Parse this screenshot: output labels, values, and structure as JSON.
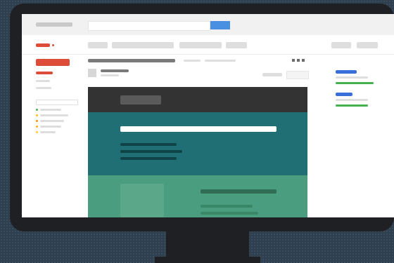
{
  "colors": {
    "background": "#2e3f4f",
    "bezel": "#1e2023",
    "brand_red": "#dd4b39",
    "search_blue": "#4a90e2",
    "link_blue": "#3b6fd8",
    "link_green": "#45b04f",
    "email_header_dark": "#333333",
    "email_teal": "#1f6f74",
    "email_green": "#4a9d7e",
    "status_dots": [
      "#4caf50",
      "#ffc107",
      "#ff9800",
      "#ffb300",
      "#ffca28"
    ]
  },
  "icons": {
    "logo": "logo-icon",
    "search": "search-icon",
    "more": "more-dots-icon",
    "avatar": "avatar-icon"
  }
}
